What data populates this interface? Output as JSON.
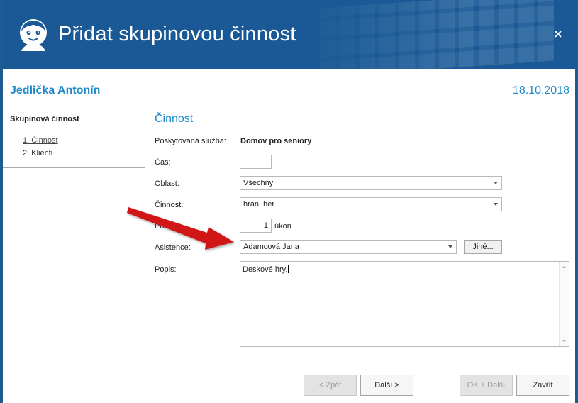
{
  "window": {
    "title": "Přidat skupinovou činnost",
    "close_label": "×"
  },
  "client": {
    "name": "Jedlička Antonín",
    "date": "18.10.2018"
  },
  "nav": {
    "title": "Skupinová činnost",
    "items": [
      {
        "label": "1. Činnost"
      },
      {
        "label": "2. Klienti"
      }
    ]
  },
  "form": {
    "section_title": "Činnost",
    "service_label": "Poskytovaná služba:",
    "service_value": "Domov pro seniory",
    "time_label": "Čas:",
    "time_value": "",
    "area_label": "Oblast:",
    "area_value": "Všechny",
    "activity_label": "Činnost:",
    "activity_value": "hraní her",
    "count_label": "Počet:",
    "count_value": "1",
    "count_unit": "úkon",
    "assist_label": "Asistence:",
    "assist_value": "Adamcová Jana",
    "assist_other_label": "Jiné...",
    "desc_label": "Popis:",
    "desc_value": "Deskové hry."
  },
  "footer": {
    "back_label": "< Zpět",
    "next_label": "Další >",
    "ok_next_label": "OK + Další",
    "close_label": "Zavřít"
  },
  "colors": {
    "header_bg": "#1a5996",
    "accent": "#1b8ac9",
    "arrow": "#d01919"
  }
}
